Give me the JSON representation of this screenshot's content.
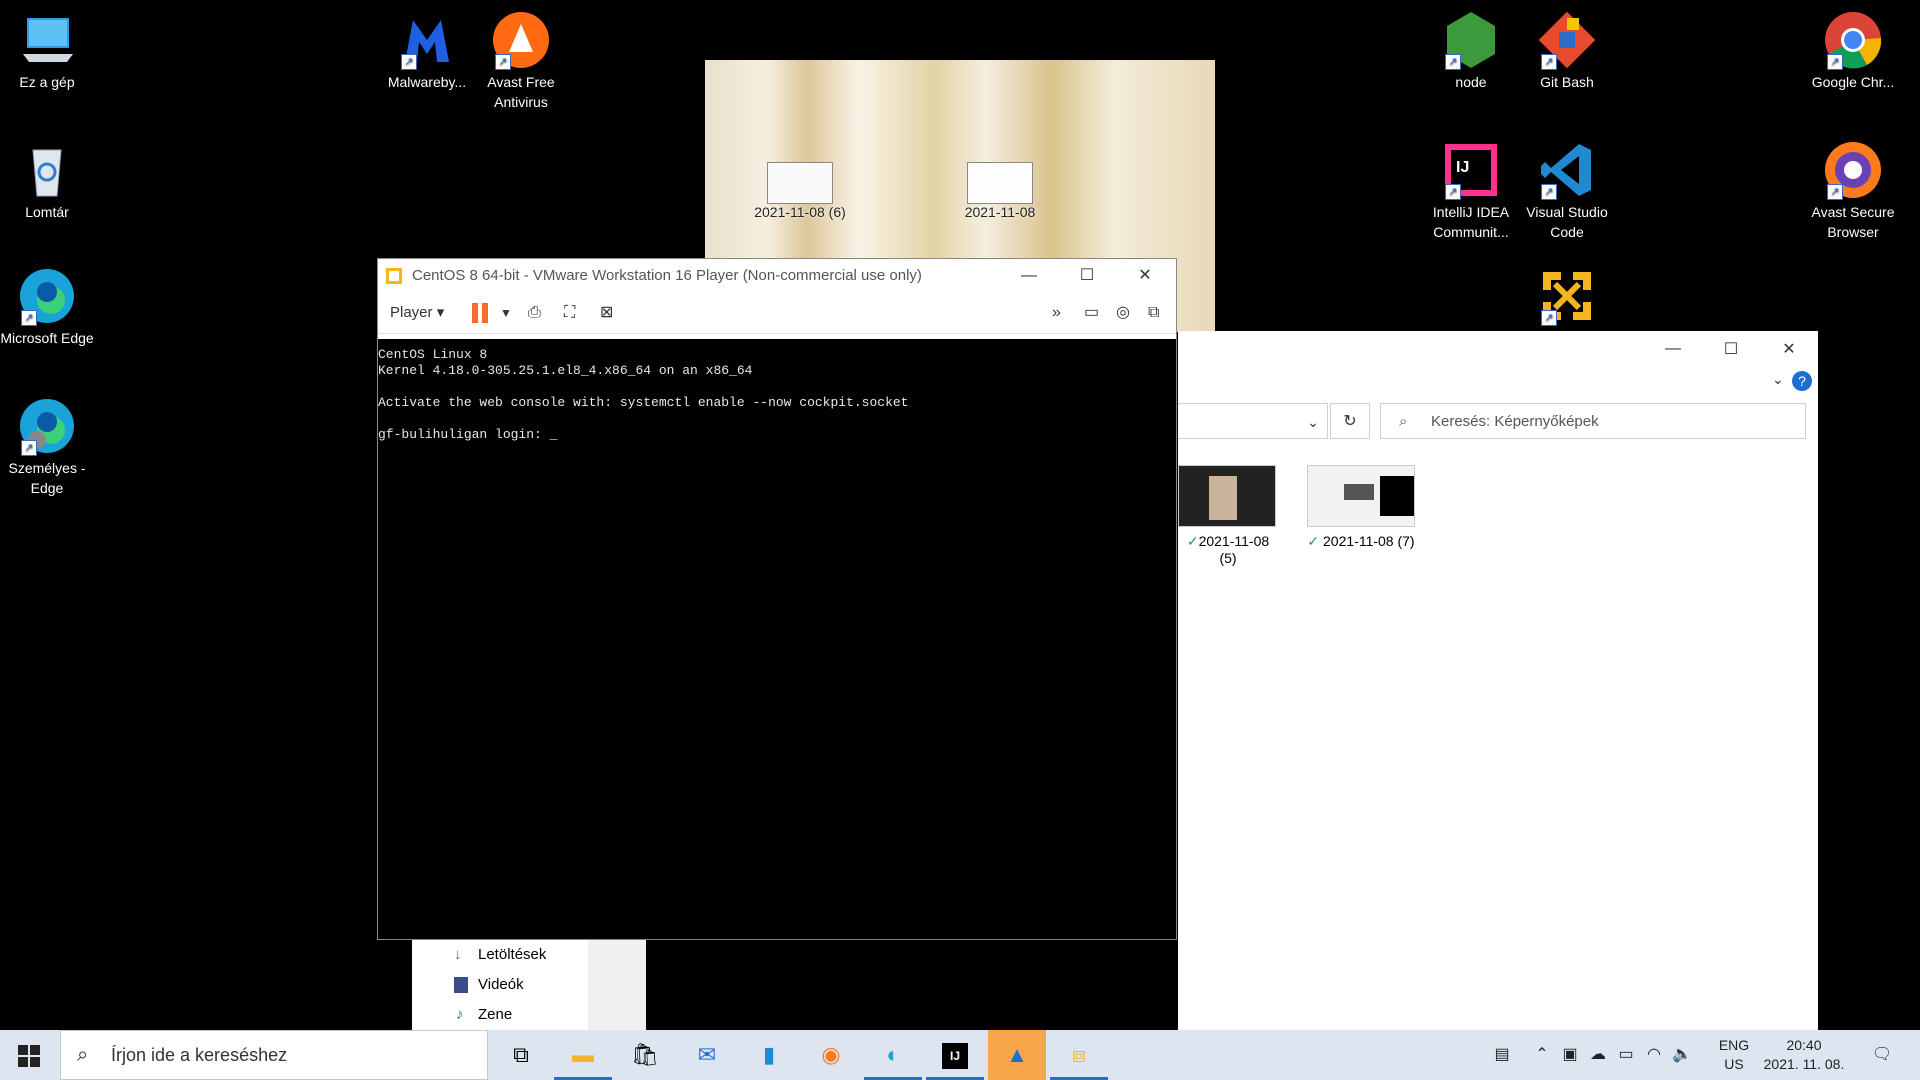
{
  "desktop": {
    "icons": [
      {
        "label": "Ez a gép"
      },
      {
        "label": "Lomtár"
      },
      {
        "label": "Microsoft Edge"
      },
      {
        "label": "Személyes - Edge"
      },
      {
        "label": "Malwareby..."
      },
      {
        "label": "Avast Free Antivirus"
      },
      {
        "label": "node"
      },
      {
        "label": "Git Bash"
      },
      {
        "label": "Google Chr..."
      },
      {
        "label": "IntelliJ IDEA Communit..."
      },
      {
        "label": "Visual Studio Code"
      },
      {
        "label": "Avast Secure Browser"
      }
    ],
    "photo_files": [
      {
        "label": "2021-11-08 (6)"
      },
      {
        "label": "2021-11-08"
      }
    ]
  },
  "vmware": {
    "title": "CentOS 8 64-bit - VMware Workstation 16 Player (Non-commercial use only)",
    "player_menu": "Player",
    "console_lines": [
      "CentOS Linux 8",
      "Kernel 4.18.0-305.25.1.el8_4.x86_64 on an x86_64",
      "",
      "Activate the web console with: systemctl enable --now cockpit.socket",
      "",
      "gf-bulihuligan login: _"
    ]
  },
  "explorer": {
    "search_placeholder": "Keresés: Képernyőképek",
    "files": [
      {
        "label": "2021-11-08 (5)"
      },
      {
        "label": "2021-11-08 (7)"
      }
    ],
    "nav_items": [
      {
        "label": "Letöltések"
      },
      {
        "label": "Videók"
      },
      {
        "label": "Zene"
      }
    ]
  },
  "taskbar": {
    "search_placeholder": "Írjon ide a kereséshez",
    "lang_top": "ENG",
    "lang_bottom": "US",
    "time": "20:40",
    "date": "2021. 11. 08."
  }
}
